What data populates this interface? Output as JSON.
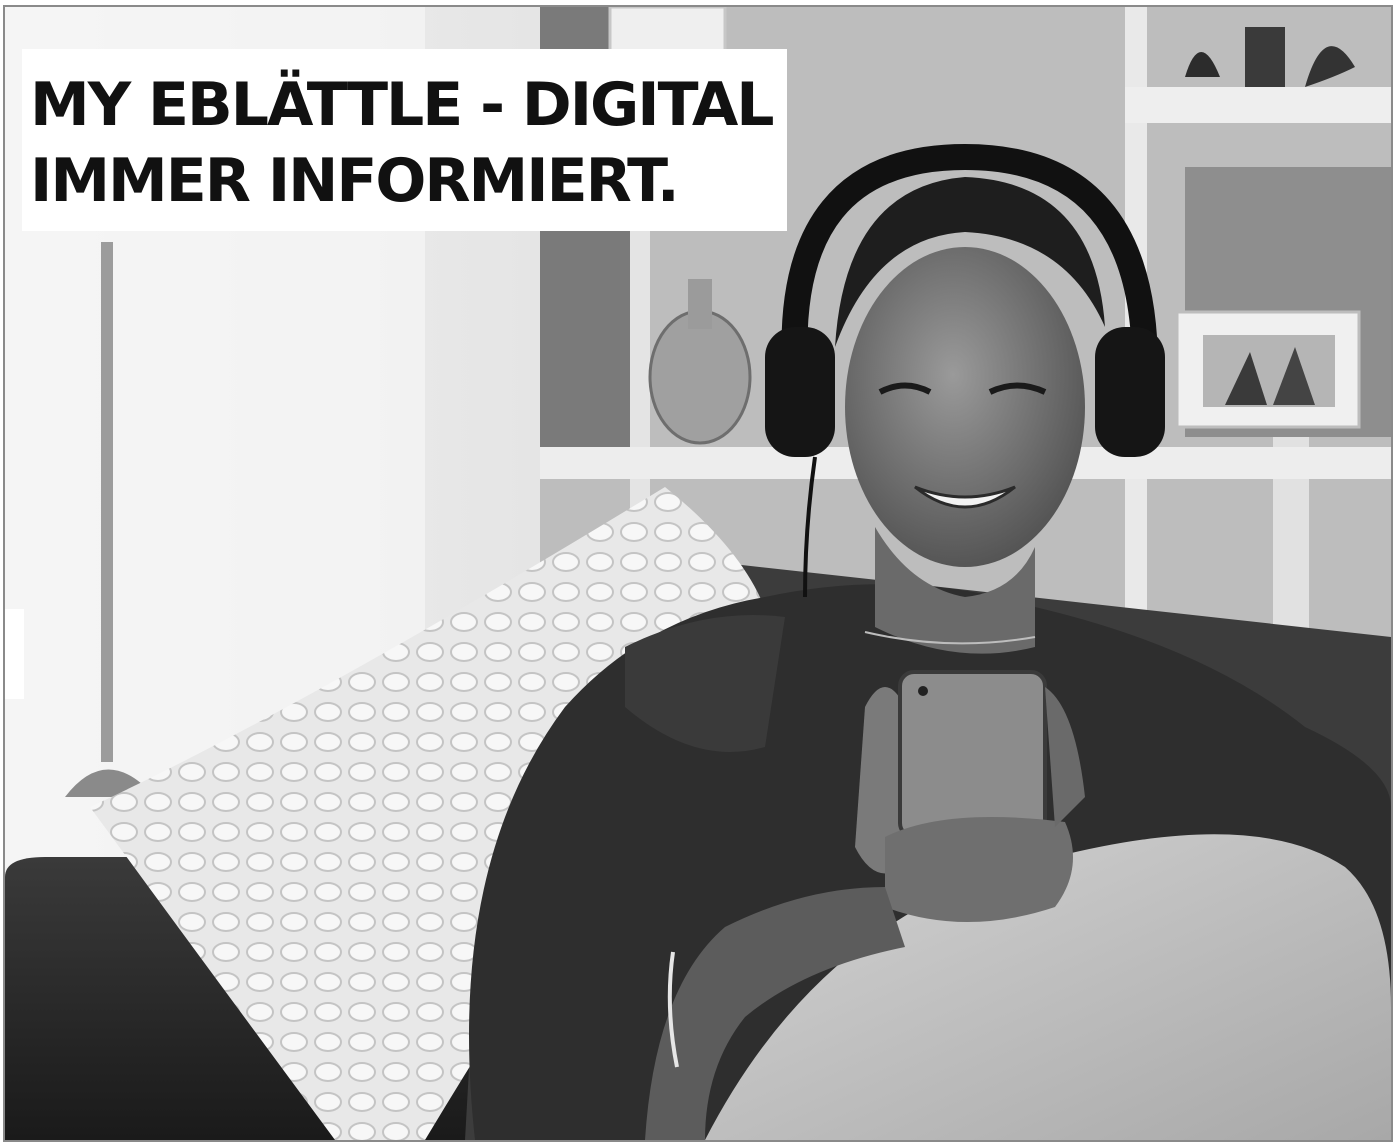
{
  "headline": {
    "line1": "MY EBLÄTTLE - DIGITAL",
    "line2": "IMMER INFORMIERT."
  },
  "colors": {
    "headline_text": "#111111",
    "headline_background": "#ffffff",
    "frame_border": "#8a8a8a"
  },
  "photo": {
    "style": "black-and-white"
  }
}
